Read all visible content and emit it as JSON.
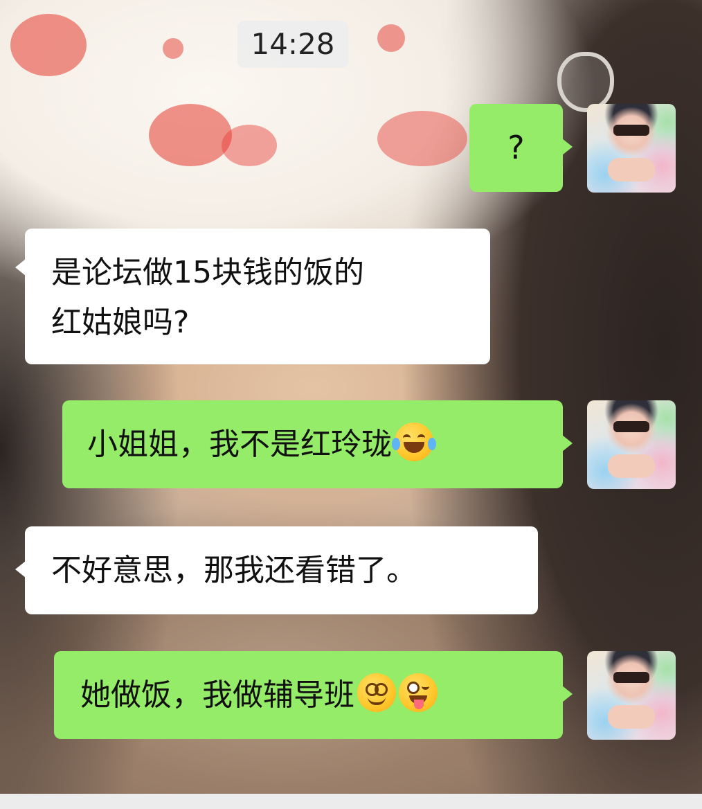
{
  "chat": {
    "timestamp": "14:28",
    "messages": [
      {
        "sender": "me",
        "text": "?"
      },
      {
        "sender": "them",
        "text_line1": "是论坛做15块钱的饭的",
        "text_line2": "红姑娘吗?"
      },
      {
        "sender": "me",
        "text": "小姐姐，我不是红玲珑",
        "emoji": "tears-of-joy-icon"
      },
      {
        "sender": "them",
        "text": "不好意思，那我还看错了。"
      },
      {
        "sender": "me",
        "text": "她做饭，我做辅导班",
        "emoji": [
          "dizzy-face-icon",
          "winking-tongue-icon"
        ]
      }
    ]
  },
  "colors": {
    "my_bubble": "#95ec69",
    "their_bubble": "#ffffff",
    "timestamp_bg": "#eeeeee"
  }
}
